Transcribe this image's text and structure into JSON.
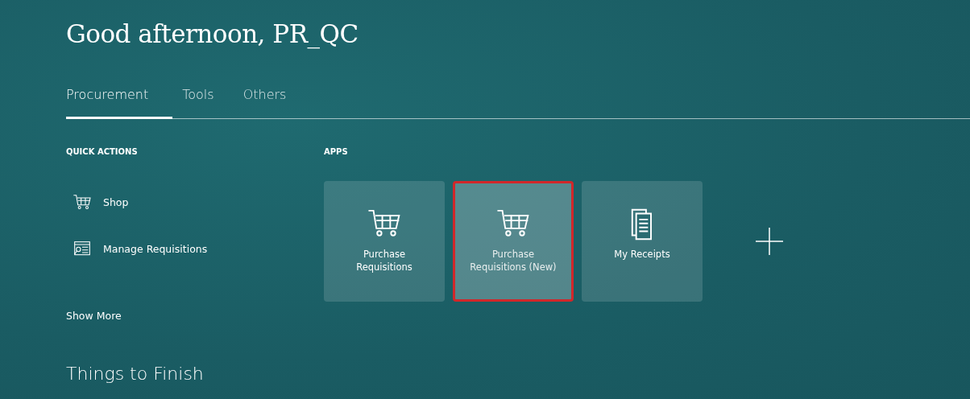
{
  "greeting": "Good afternoon, PR_QC",
  "tabs": [
    {
      "label": "Procurement",
      "selected": true
    },
    {
      "label": "Tools",
      "selected": false
    },
    {
      "label": "Others",
      "selected": false
    }
  ],
  "quick_actions": {
    "title": "QUICK ACTIONS",
    "items": [
      {
        "label": "Shop",
        "kind": "cart"
      },
      {
        "label": "Manage Requisitions",
        "kind": "search"
      }
    ],
    "show_more": "Show More"
  },
  "apps": {
    "title": "APPS",
    "tiles": [
      {
        "label": "Purchase Requisitions",
        "kind": "cart",
        "highlighted": false
      },
      {
        "label": "Purchase Requisitions (New)",
        "kind": "cart",
        "highlighted": true
      },
      {
        "label": "My Receipts",
        "kind": "documents",
        "highlighted": false
      }
    ]
  },
  "things_to_finish": "Things to Finish"
}
